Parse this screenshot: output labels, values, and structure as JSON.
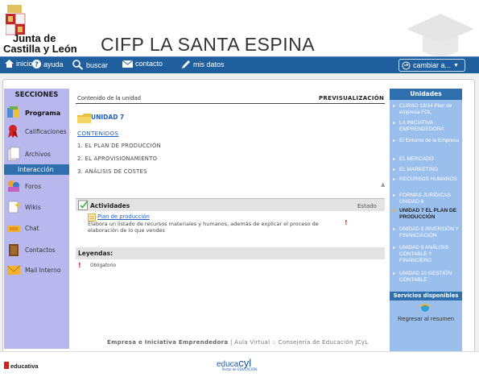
{
  "header": {
    "org_line1": "Junta de",
    "org_line2": "Castilla y León",
    "site_title": "CIFP LA SANTA ESPINA"
  },
  "nav": {
    "inicio": "inicio",
    "ayuda": "ayuda",
    "buscar": "buscar",
    "contacto": "contacto",
    "mis_datos": "mis datos",
    "cambiar": "cambiar a..."
  },
  "secciones": {
    "header": "SECCIONES",
    "items": [
      {
        "label": "Programa",
        "icon": "program-icon"
      },
      {
        "label": "Calificaciones",
        "icon": "ribbon-icon"
      },
      {
        "label": "Archivos",
        "icon": "files-icon"
      },
      {
        "label": "Interacción",
        "icon": ""
      },
      {
        "label": "Foros",
        "icon": "forum-icon"
      },
      {
        "label": "Wikis",
        "icon": "wiki-icon"
      },
      {
        "label": "Chat",
        "icon": "chat-icon"
      },
      {
        "label": "Contactos",
        "icon": "contacts-icon"
      },
      {
        "label": "Mail Interno",
        "icon": "mail-icon"
      }
    ]
  },
  "main": {
    "breadcrumb": "Contenido de la unidad",
    "preview": "PREVISUALIZACIÓN",
    "unit_title": "UNIDAD 7",
    "contenidos": "CONTENIDOS",
    "contents": [
      "1. EL PLAN DE PRODUCCIÓN",
      "2. EL APROVISIONAMIENTO",
      "3. ANÁLISIS DE COSTES"
    ],
    "activities_title": "Actividades",
    "estado": "Estado",
    "activity_link": "Plan de producción",
    "activity_desc": "Elabora un listado de recursos materiales y humanos, además de explicar el proceso de elaboración de lo que vendes",
    "activity_status": "!",
    "legend_title": "Leyendas:",
    "legend_mark": "!",
    "legend_text": "Obligatorio",
    "scroll_up": "▲"
  },
  "unidades": {
    "header": "Unidades",
    "items": [
      "CURSO 13/14 Plan de empresa FOL",
      "LA INICIATIVA EMPRENDEDORA",
      "El Entorno de la Empresa",
      "EL MERCADO",
      "EL MARKETING",
      "RECURSOS HUMANOS",
      "FORMAS JURÍDICAS UNIDAD 6",
      "UNIDAD 7 EL PLAN DE PRODUCCIÓN",
      "UNIDAD 8 INVERSIÓN Y FINANCIACIÓN",
      "UNIDAD 9 ANÁLISIS CONTABLE Y FINANCIERO",
      "UNIDAD 10 GESTIÓN CONTABLE"
    ],
    "current_index": 7,
    "services_header": "Servicios disponibles",
    "regresar": "Regresar al resumen"
  },
  "footer": {
    "course": "Empresa e Iniciativa Emprendedora",
    "sep": " | ",
    "aula": "Aula Virtual :: Consejería de Educación JCyL",
    "educativa": "educativa",
    "educa": "educa",
    "cyl": "cyl",
    "portal": "Portal de EDUCACIÓN"
  },
  "colors": {
    "nav_bg": "#1f5f9e",
    "left_col": "#b8b8ee",
    "right_col": "#9abfec",
    "accent_blue": "#2f6fae",
    "link": "#1f5fbe",
    "required": "#d22222"
  }
}
